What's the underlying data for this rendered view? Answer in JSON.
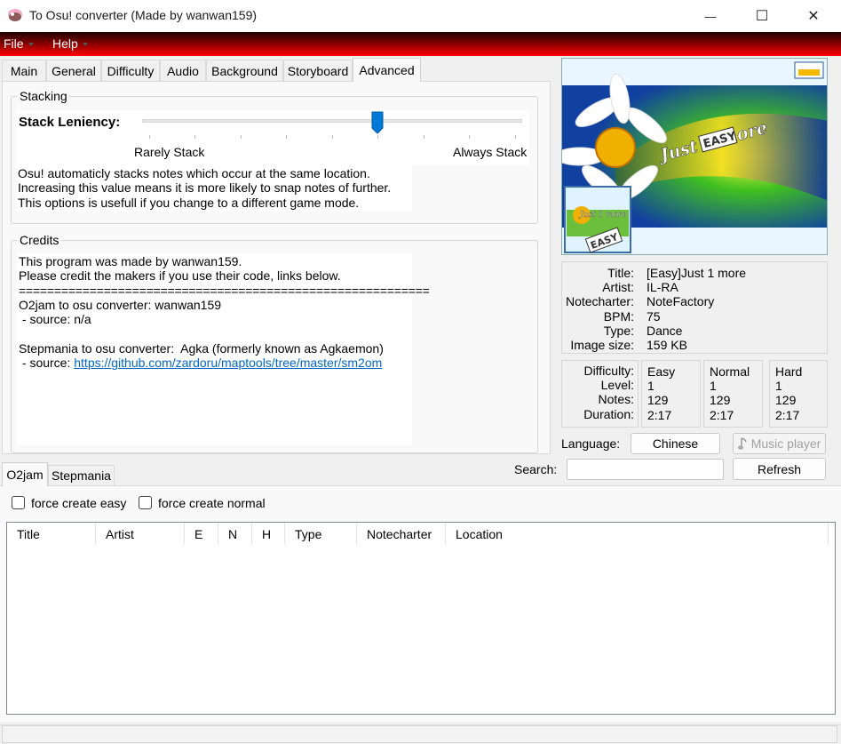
{
  "window": {
    "title": "To Osu! converter (Made by wanwan159)",
    "minimize_glyph": "—",
    "maximize_glyph": "☐",
    "close_glyph": "✕"
  },
  "menu": {
    "file": "File",
    "help": "Help"
  },
  "tabs": [
    {
      "label": "Main"
    },
    {
      "label": "General"
    },
    {
      "label": "Difficulty"
    },
    {
      "label": "Audio"
    },
    {
      "label": "Background"
    },
    {
      "label": "Storyboard"
    },
    {
      "label": "Advanced",
      "active": true
    }
  ],
  "stacking": {
    "legend": "Stacking",
    "label": "Stack Leniency:",
    "min_label": "Rarely Stack",
    "max_label": "Always Stack",
    "slider_level": 0.6,
    "description": "Osu! automaticly stacks notes which occur at the same location. Increasing this value means it is more likely to snap notes of further. This options is usefull if you change to a different game mode."
  },
  "credits": {
    "legend": "Credits",
    "line1": "This program was made by wanwan159.",
    "line2": "Please credit the makers if you use their code, links below.",
    "separator": "==========================================================",
    "line4": "O2jam to osu converter: wanwan159",
    "line5": " - source: n/a",
    "line6": "Stepmania to osu converter:  Agka (formerly known as Agkaemon)",
    "line7_prefix": " - source: ",
    "link": "https://github.com/zardoru/maptools/tree/master/sm2om"
  },
  "song": {
    "labels": {
      "title": "Title:",
      "artist": "Artist:",
      "notecharter": "Notecharter:",
      "bpm": "BPM:",
      "type": "Type:",
      "image_size": "Image size:"
    },
    "title": "[Easy]Just 1 more",
    "artist": "IL-RA",
    "notecharter": "NoteFactory",
    "bpm": "75",
    "type": "Dance",
    "image_size": "159 KB",
    "cover_text": "Just 1 more",
    "cover_badge": "EASY"
  },
  "difficulty": {
    "labels": {
      "difficulty": "Difficulty:",
      "level": "Level:",
      "notes": "Notes:",
      "duration": "Duration:"
    },
    "columns": [
      {
        "name": "Easy",
        "level": "1",
        "notes": "129",
        "duration": "2:17"
      },
      {
        "name": "Normal",
        "level": "1",
        "notes": "129",
        "duration": "2:17"
      },
      {
        "name": "Hard",
        "level": "1",
        "notes": "129",
        "duration": "2:17"
      }
    ]
  },
  "language": {
    "label": "Language:",
    "button": "Chinese"
  },
  "music_player_label": "Music player",
  "bottom_tabs": [
    {
      "label": "O2jam",
      "active": true
    },
    {
      "label": "Stepmania"
    }
  ],
  "search": {
    "label": "Search:",
    "value": ""
  },
  "refresh_label": "Refresh",
  "options": {
    "force_easy": "force create easy",
    "force_normal": "force create normal"
  },
  "list_columns": [
    "Title",
    "Artist",
    "E",
    "N",
    "H",
    "Type",
    "Notecharter",
    "Location"
  ]
}
